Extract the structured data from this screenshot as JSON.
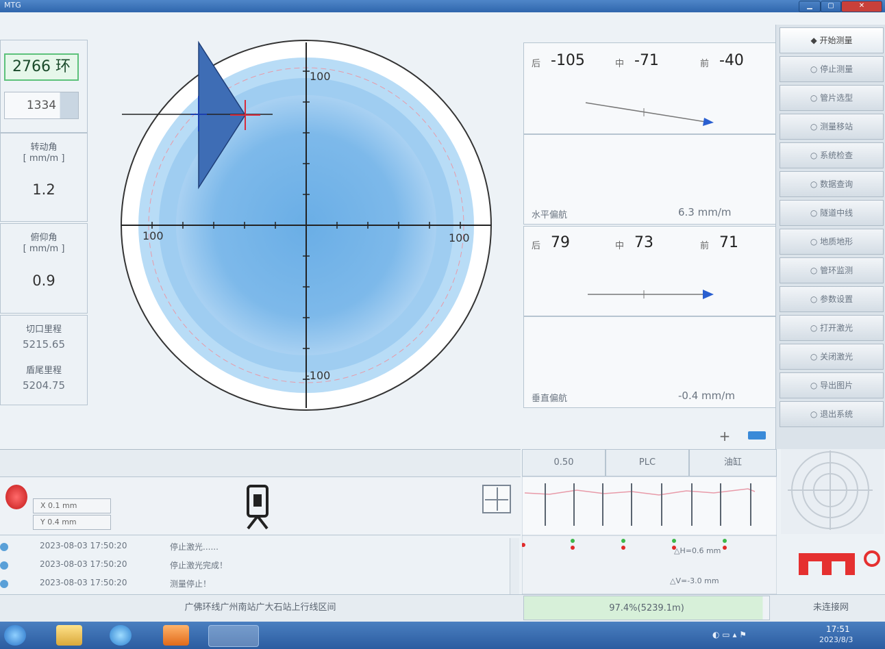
{
  "left": {
    "ring_count": "2766 环",
    "sub_count": "1334",
    "rotation": {
      "label": "转动角",
      "unit": "[ mm/m ]",
      "value": "1.2"
    },
    "pitch": {
      "label": "俯仰角",
      "unit": "[ mm/m ]",
      "value": "0.9"
    },
    "cut_mileage": {
      "label": "切口里程",
      "value": "5215.65"
    },
    "tail_mileage": {
      "label": "盾尾里程",
      "value": "5204.75"
    }
  },
  "target": {
    "axis_top": "100",
    "axis_left": "100",
    "axis_right": "100",
    "axis_bottom": "-100"
  },
  "horizontal": {
    "rear_label": "后",
    "rear": "-105",
    "mid_label": "中",
    "mid": "-71",
    "front_label": "前",
    "front": "-40",
    "dev_label": "水平偏航",
    "dev_value": "6.3 mm/m"
  },
  "vertical": {
    "rear_label": "后",
    "rear": "79",
    "mid_label": "中",
    "mid": "73",
    "front_label": "前",
    "front": "71",
    "dev_label": "垂直偏航",
    "dev_value": "-0.4 mm/m"
  },
  "sidebar": {
    "items": [
      "开始测量",
      "停止测量",
      "管片选型",
      "测量移站",
      "系统检查",
      "数据查询",
      "隧道中线",
      "地质地形",
      "管环监测",
      "参数设置",
      "打开激光",
      "关闭激光",
      "导出图片",
      "退出系统"
    ]
  },
  "bottom": {
    "xy": {
      "x": "X  0.1 mm",
      "y": "Y  0.4 mm"
    },
    "tabs": [
      "0.50",
      "PLC",
      "油缸"
    ],
    "log": [
      {
        "time": "2023-08-03 17:50:20",
        "msg": "停止激光......"
      },
      {
        "time": "2023-08-03 17:50:20",
        "msg": "停止激光完成！"
      },
      {
        "time": "2023-08-03 17:50:20",
        "msg": "测量停止！"
      }
    ],
    "chart_note_1": "△H=0.6 mm",
    "chart_note_2": "△V=-3.0 mm",
    "project": "广佛环线广州南站广大石站上行线区间",
    "progress": "97.4%(5239.1m)",
    "footer_right": "未连接网"
  },
  "taskbar": {
    "time": "17:51",
    "date": "2023/8/3"
  },
  "colors": {
    "accent": "#2f66ad",
    "target_fill": "#5aa0e0",
    "marker": "#3e6db5",
    "logo": "#e53030"
  }
}
